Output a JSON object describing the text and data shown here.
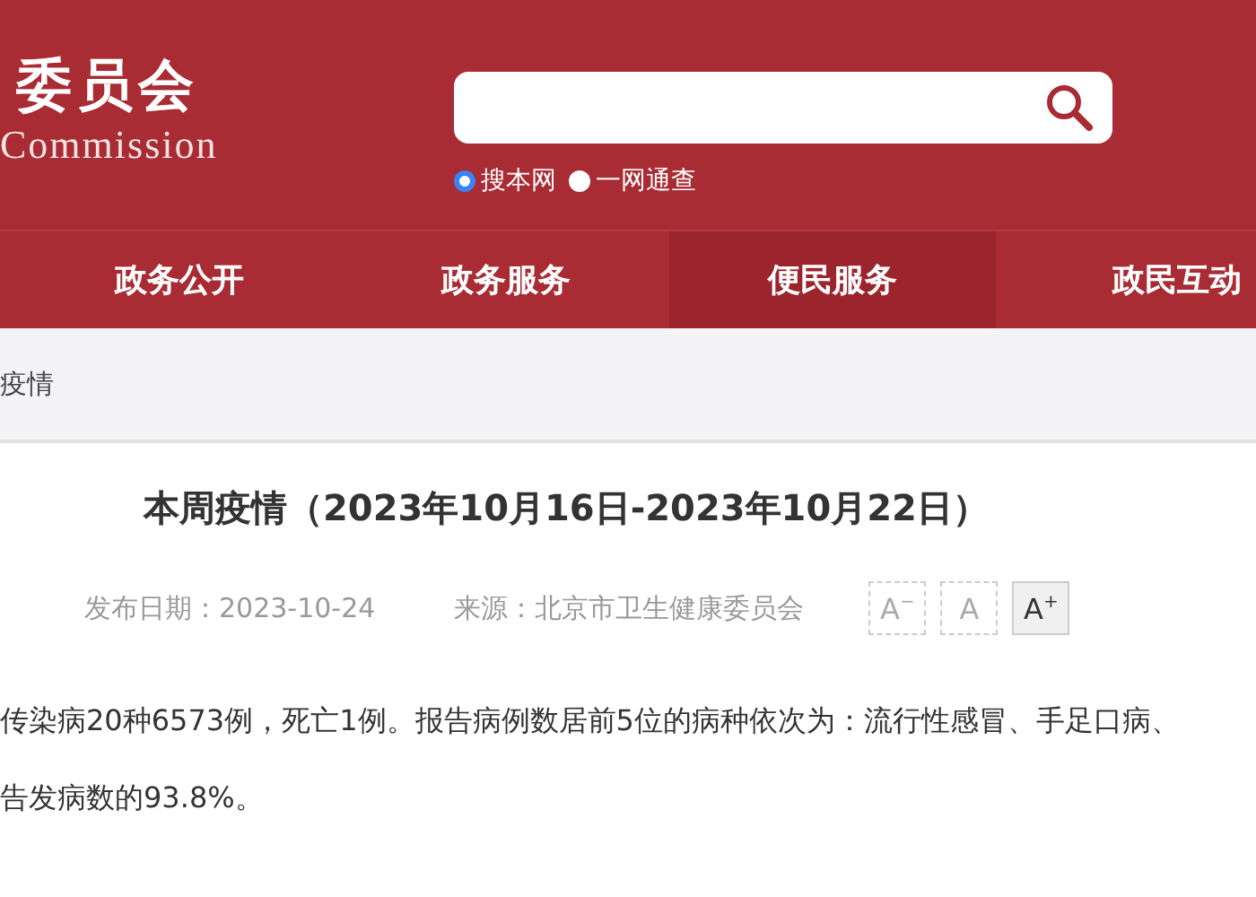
{
  "header": {
    "logo_cn": "委员会",
    "logo_en": "Commission",
    "search": {
      "options": [
        {
          "label": "搜本网",
          "selected": true
        },
        {
          "label": "一网通查",
          "selected": false
        }
      ]
    }
  },
  "nav": [
    {
      "label": "政务公开",
      "selected": false
    },
    {
      "label": "政务服务",
      "selected": false
    },
    {
      "label": "便民服务",
      "selected": true
    },
    {
      "label": "政民互动",
      "selected": false
    }
  ],
  "breadcrumb": "疫情",
  "article": {
    "title": "本周疫情（2023年10月16日-2023年10月22日）",
    "date": "发布日期：2023-10-24",
    "source": "来源：北京市卫生健康委员会",
    "font_sizes": [
      {
        "label": "A",
        "mark": "−",
        "selected": false
      },
      {
        "label": "A",
        "selected": false
      },
      {
        "label": "A",
        "mark": "+",
        "selected": true
      }
    ],
    "paragraphs": [
      "传染病20种6573例，死亡1例。报告病例数居前5位的病种依次为：流行性感冒、手足口病、",
      "告发病数的93.8%。"
    ]
  }
}
